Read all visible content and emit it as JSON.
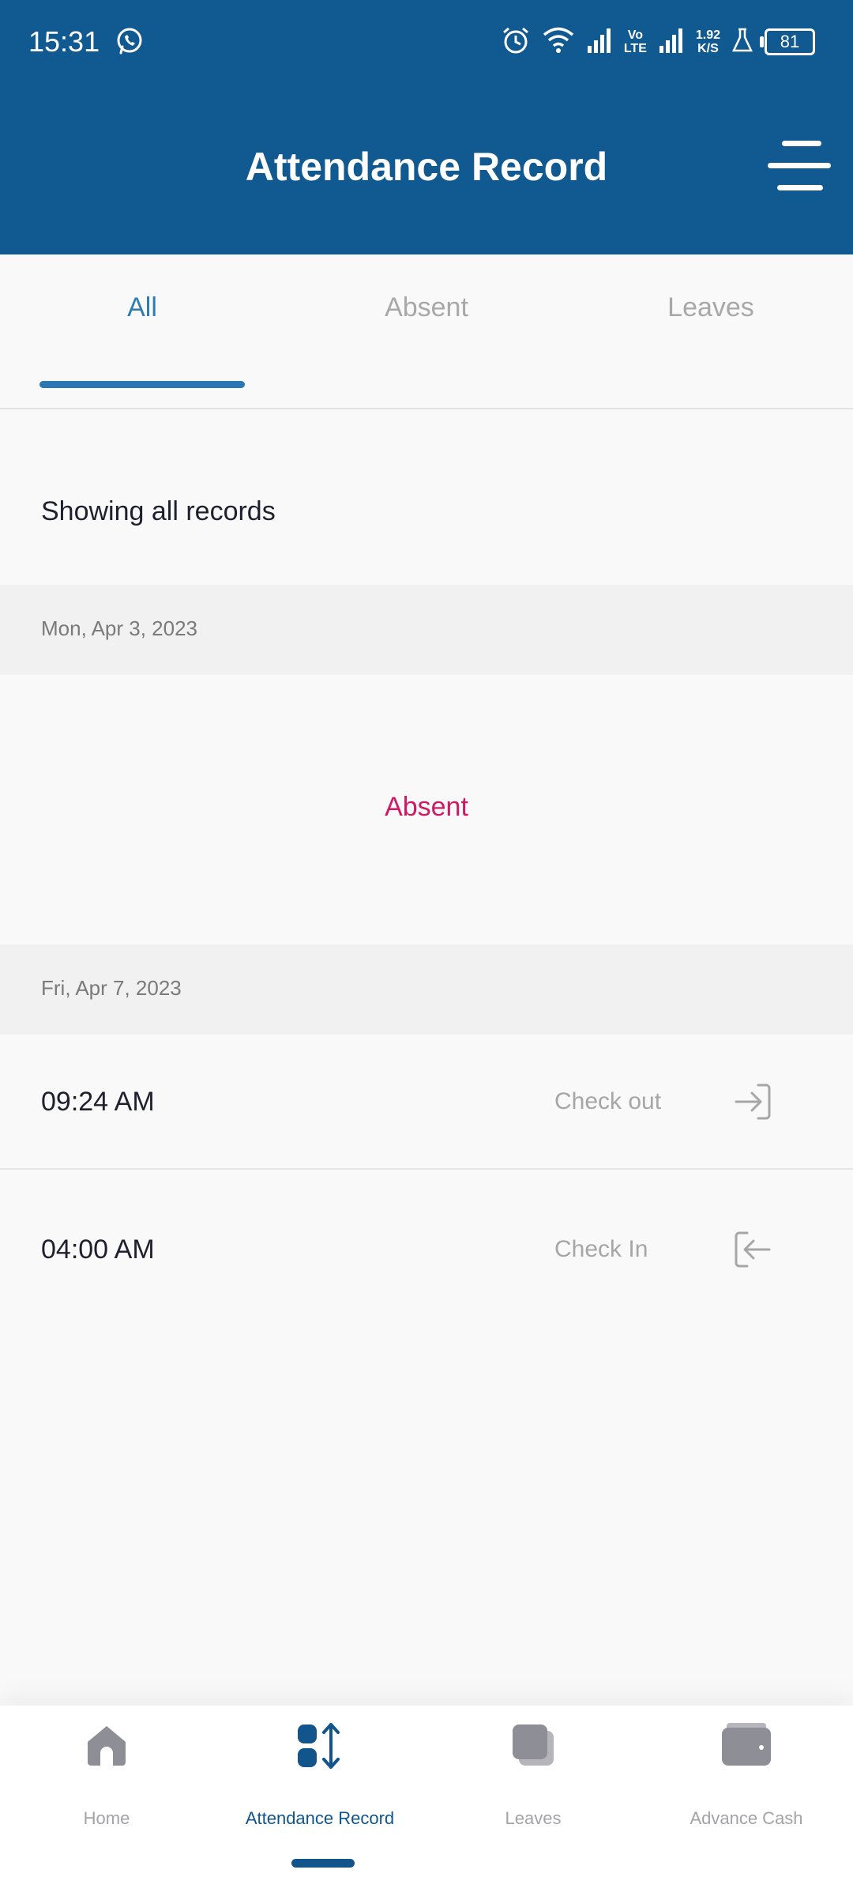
{
  "status_bar": {
    "time": "15:31",
    "net_speed_value": "1.92",
    "net_speed_unit": "K/S",
    "volte_top": "Vo",
    "volte_bottom": "LTE",
    "battery": "81"
  },
  "header": {
    "title": "Attendance Record",
    "background_color": "#115a91"
  },
  "tabs": [
    {
      "label": "All",
      "active": true
    },
    {
      "label": "Absent",
      "active": false
    },
    {
      "label": "Leaves",
      "active": false
    }
  ],
  "filter_text": "Showing all records",
  "days": [
    {
      "date": "Mon, Apr 3, 2023",
      "status": "Absent",
      "status_color": "#d01962"
    },
    {
      "date": "Fri, Apr 7, 2023",
      "records": [
        {
          "time": "09:24 AM",
          "type": "Check out",
          "icon": "check-out-icon"
        },
        {
          "time": "04:00 AM",
          "type": "Check In",
          "icon": "check-in-icon"
        }
      ]
    }
  ],
  "bottom_nav": [
    {
      "label": "Home",
      "icon": "home-icon",
      "active": false
    },
    {
      "label": "Attendance Record",
      "icon": "attendance-icon",
      "active": true
    },
    {
      "label": "Leaves",
      "icon": "leaves-icon",
      "active": false
    },
    {
      "label": "Advance Cash",
      "icon": "wallet-icon",
      "active": false
    }
  ]
}
